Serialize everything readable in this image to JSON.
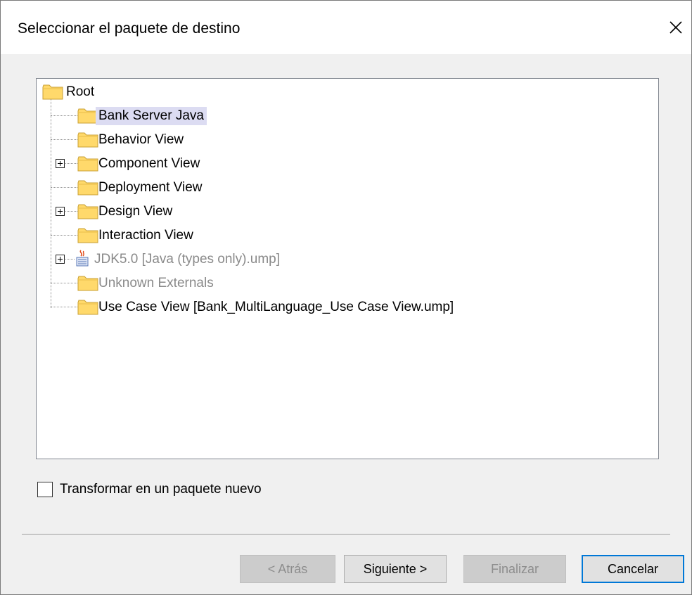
{
  "dialog": {
    "title": "Seleccionar el paquete de destino",
    "close_icon": "close-icon"
  },
  "tree": {
    "root": {
      "label": "Root",
      "icon": "folder-icon"
    },
    "items": [
      {
        "label": "Bank Server Java",
        "icon": "folder-icon",
        "expandable": false,
        "selected": true,
        "disabled": false
      },
      {
        "label": "Behavior View",
        "icon": "folder-icon",
        "expandable": false,
        "selected": false,
        "disabled": false
      },
      {
        "label": "Component View",
        "icon": "folder-icon",
        "expandable": true,
        "selected": false,
        "disabled": false
      },
      {
        "label": "Deployment View",
        "icon": "folder-icon",
        "expandable": false,
        "selected": false,
        "disabled": false
      },
      {
        "label": "Design View",
        "icon": "folder-icon",
        "expandable": true,
        "selected": false,
        "disabled": false
      },
      {
        "label": "Interaction View",
        "icon": "folder-icon",
        "expandable": false,
        "selected": false,
        "disabled": false
      },
      {
        "label": "JDK5.0 [Java (types only).ump]",
        "icon": "java-package-icon",
        "expandable": true,
        "selected": false,
        "disabled": true
      },
      {
        "label": "Unknown Externals",
        "icon": "folder-icon",
        "expandable": false,
        "selected": false,
        "disabled": true
      },
      {
        "label": "Use Case View [Bank_MultiLanguage_Use Case View.ump]",
        "icon": "folder-icon",
        "expandable": false,
        "selected": false,
        "disabled": false
      }
    ]
  },
  "options": {
    "new_package_label": "Transformar en un paquete nuevo",
    "new_package_checked": false
  },
  "buttons": {
    "back": "< Atrás",
    "next": "Siguiente >",
    "finish": "Finalizar",
    "cancel": "Cancelar"
  },
  "colors": {
    "selection": "#dcdcf2",
    "folder_fill": "#ffd96b",
    "folder_stroke": "#c8a035",
    "accent": "#0078d7"
  }
}
